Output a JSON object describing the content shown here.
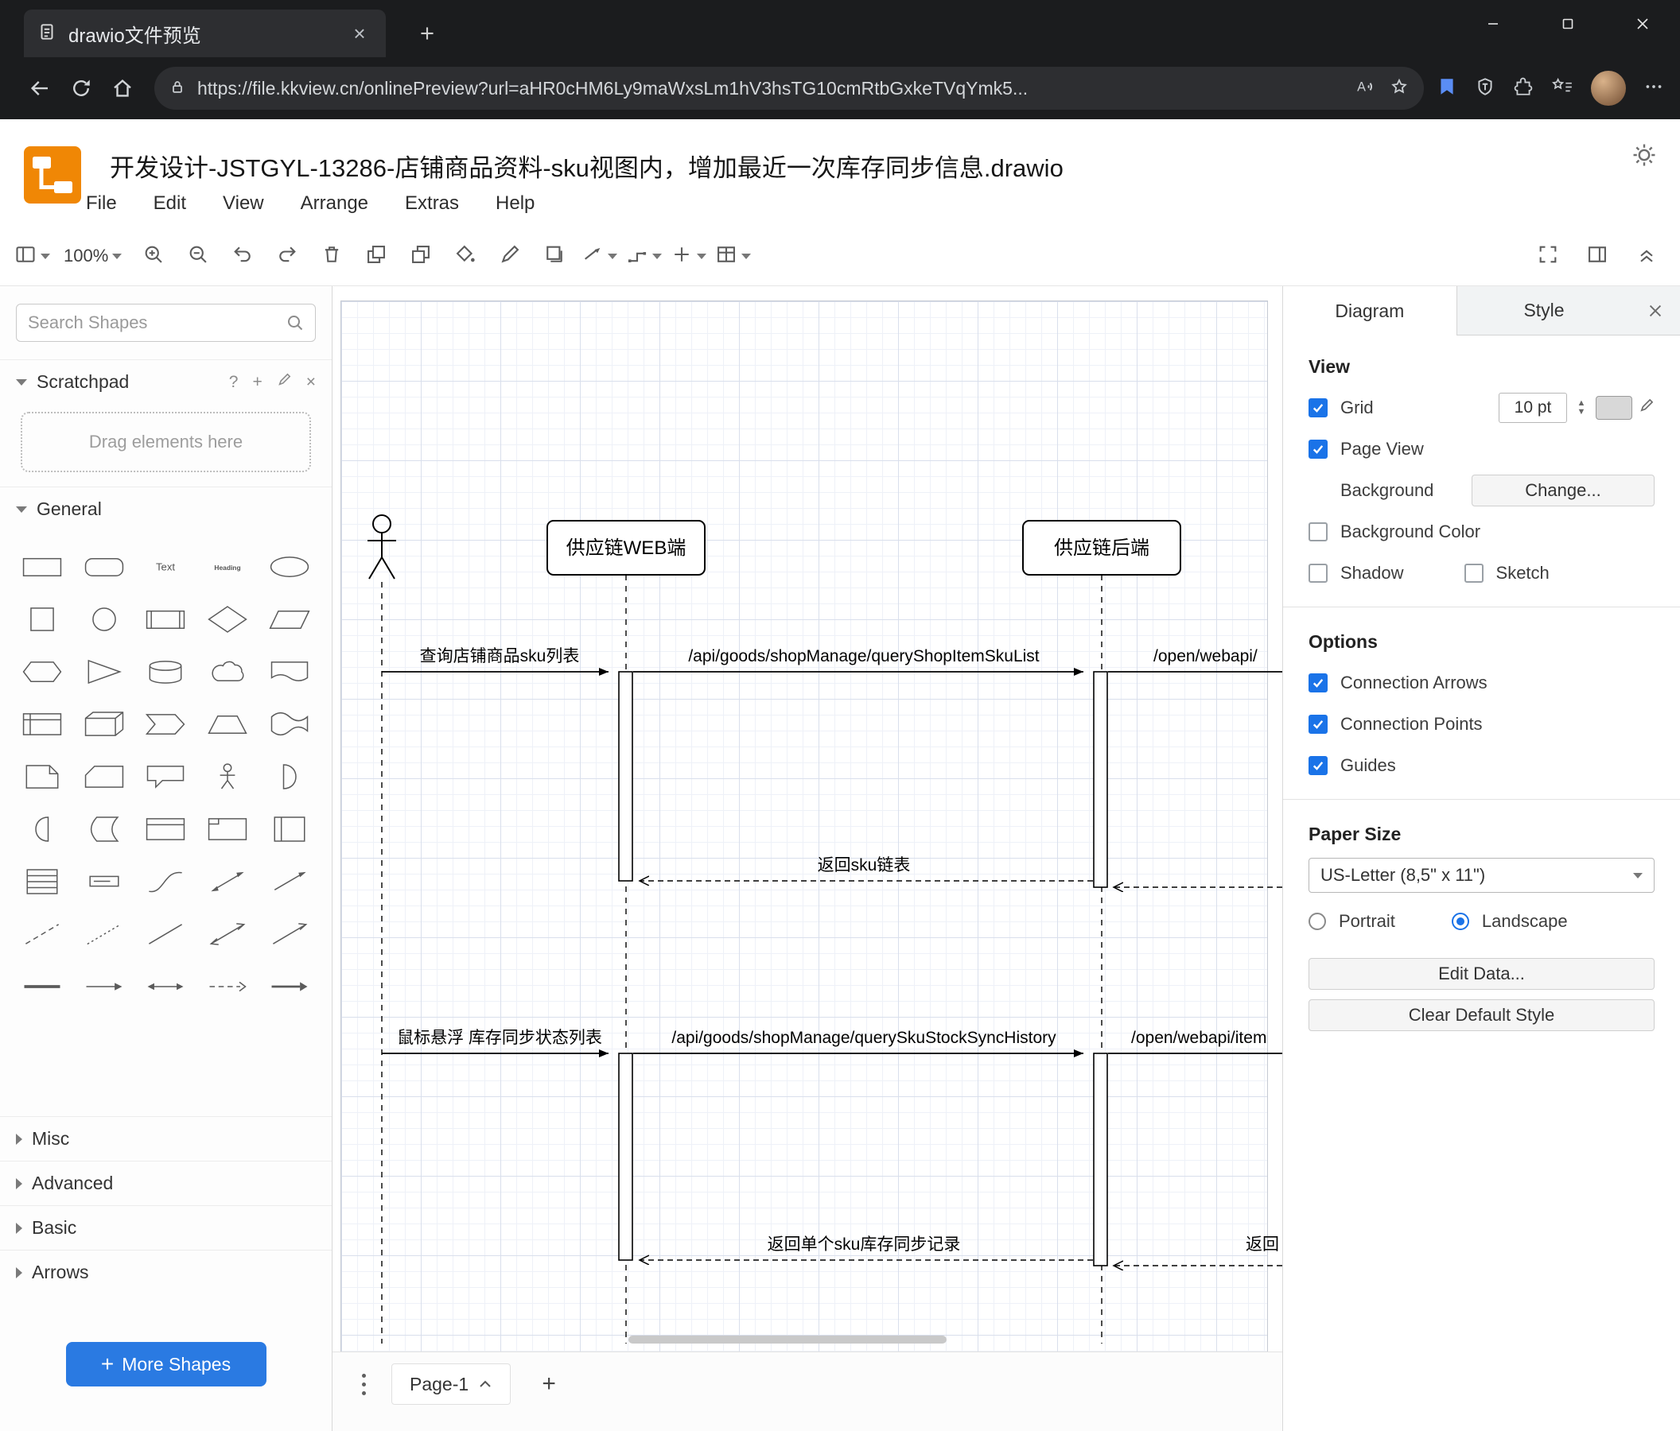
{
  "browser": {
    "tab_title": "drawio文件预览",
    "url": "https://file.kkview.cn/onlinePreview?url=aHR0cHM6Ly9maWxsLm1hV3hsTG10cmRtbGxkeTVqYmk5...",
    "icons": [
      "document-icon",
      "close-tab-icon",
      "new-tab-icon",
      "minimize-icon",
      "maximize-icon",
      "close-window-icon",
      "back-icon",
      "reload-icon",
      "home-icon",
      "lock-icon",
      "read-aloud-icon",
      "favorite-star-icon",
      "bookmark-blue-icon",
      "shield-icon",
      "extensions-icon",
      "favorites-bar-icon",
      "profile-avatar",
      "more-menu-icon"
    ]
  },
  "app": {
    "file_title": "开发设计-JSTGYL-13286-店铺商品资料-sku视图内，增加最近一次库存同步信息.drawio",
    "menus": [
      "File",
      "Edit",
      "View",
      "Arrange",
      "Extras",
      "Help"
    ],
    "toolbar": {
      "zoom_level": "100%",
      "left_icons": [
        "sidebar-view",
        "zoom-level",
        "zoom-in",
        "zoom-out",
        "undo",
        "redo",
        "delete",
        "to-front",
        "to-back",
        "fill-color",
        "line-color",
        "shadow",
        "connection",
        "waypoints",
        "insert",
        "table"
      ],
      "right_icons": [
        "fullscreen",
        "format-panel",
        "collapse"
      ]
    }
  },
  "sidebar": {
    "search_placeholder": "Search Shapes",
    "scratchpad_label": "Scratchpad",
    "scratchpad_hint": "Drag elements here",
    "general_label": "General",
    "sections": [
      "Misc",
      "Advanced",
      "Basic",
      "Arrows"
    ],
    "more_shapes_label": "More Shapes",
    "shapes": [
      {
        "name": "rectangle"
      },
      {
        "name": "rounded-rectangle"
      },
      {
        "name": "text",
        "label": "Text"
      },
      {
        "name": "heading",
        "label": "Heading"
      },
      {
        "name": "ellipse"
      },
      {
        "name": "square"
      },
      {
        "name": "circle"
      },
      {
        "name": "process"
      },
      {
        "name": "diamond"
      },
      {
        "name": "parallelogram"
      },
      {
        "name": "hexagon"
      },
      {
        "name": "triangle"
      },
      {
        "name": "cylinder"
      },
      {
        "name": "cloud"
      },
      {
        "name": "document"
      },
      {
        "name": "internal-storage"
      },
      {
        "name": "cube"
      },
      {
        "name": "step"
      },
      {
        "name": "trapezoid"
      },
      {
        "name": "tape"
      },
      {
        "name": "note"
      },
      {
        "name": "card"
      },
      {
        "name": "callout"
      },
      {
        "name": "actor"
      },
      {
        "name": "or"
      },
      {
        "name": "and"
      },
      {
        "name": "data-storage"
      },
      {
        "name": "container"
      },
      {
        "name": "frame"
      },
      {
        "name": "vertical-container"
      },
      {
        "name": "list"
      },
      {
        "name": "list-item"
      },
      {
        "name": "curve"
      },
      {
        "name": "bidirectional-arrow"
      },
      {
        "name": "arrow"
      },
      {
        "name": "dashed-line"
      },
      {
        "name": "dotted-line"
      },
      {
        "name": "line"
      },
      {
        "name": "bidirectional-connector"
      },
      {
        "name": "directional-connector"
      },
      {
        "name": "divider"
      },
      {
        "name": "horizontal-arrow"
      },
      {
        "name": "double-arrow"
      },
      {
        "name": "dashed-arrow"
      },
      {
        "name": "filled-edge"
      }
    ]
  },
  "canvas": {
    "page_tab": "Page-1",
    "diagram": {
      "participant1": "供应链WEB端",
      "participant2": "供应链后端",
      "msg_query_sku_list": "查询店铺商品sku列表",
      "api_query_shop_item_sku_list": "/api/goods/shopManage/queryShopItemSkuList",
      "api_open_webapi": "/open/webapi/",
      "return_sku_list": "返回sku链表",
      "msg_hover_stock_sync": "鼠标悬浮 库存同步状态列表",
      "api_query_sku_stock_sync_history": "/api/goods/shopManage/querySkuStockSyncHistory",
      "api_open_webapi_item": "/open/webapi/item",
      "return_single_sku_record": "返回单个sku库存同步记录",
      "return_truncated": "返回"
    }
  },
  "panel": {
    "tabs": [
      "Diagram",
      "Style"
    ],
    "view": {
      "heading": "View",
      "grid": "Grid",
      "grid_size": "10 pt",
      "page_view": "Page View",
      "background": "Background",
      "change": "Change...",
      "background_color": "Background Color",
      "shadow": "Shadow",
      "sketch": "Sketch"
    },
    "options": {
      "heading": "Options",
      "items": [
        "Connection Arrows",
        "Connection Points",
        "Guides"
      ]
    },
    "paper": {
      "heading": "Paper Size",
      "size": "US-Letter (8,5\" x 11\")",
      "portrait": "Portrait",
      "landscape": "Landscape"
    },
    "buttons": {
      "edit_data": "Edit Data...",
      "clear_default_style": "Clear Default Style"
    }
  }
}
